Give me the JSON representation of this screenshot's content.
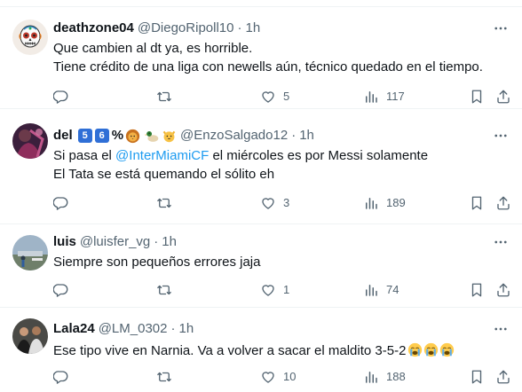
{
  "tweets": [
    {
      "display_name": "deathzone04",
      "handle": "@DiegoRipoll10",
      "time": "1h",
      "lines": [
        "Que cambien al dt ya, es horrible.",
        "Tiene crédito de una liga con newells aún, técnico quedado en el tiempo."
      ],
      "likes": "5",
      "views": "117"
    },
    {
      "display_name": "del",
      "name_badges": [
        "5",
        "6"
      ],
      "name_suffix": "%",
      "name_emojis": [
        "lion-emoji",
        "duck-emoji",
        "cat-emoji"
      ],
      "handle": "@EnzoSalgado12",
      "time": "1h",
      "line1_prefix": "Si pasa el ",
      "line1_mention": "@InterMiamiCF",
      "line1_suffix": " el miércoles es por Messi solamente",
      "line2": "El Tata se está quemando el sólito eh",
      "likes": "3",
      "views": "189"
    },
    {
      "display_name": "luis",
      "handle": "@luisfer_vg",
      "time": "1h",
      "lines": [
        "Siempre son pequeños errores jaja"
      ],
      "likes": "1",
      "views": "74"
    },
    {
      "display_name": "Lala24",
      "handle": "@LM_0302",
      "time": "1h",
      "line1": "Ese tipo vive en Narnia. Va a volver a sacar el maldito 3-5-2",
      "line1_emojis": [
        "loudly-crying-face-emoji",
        "loudly-crying-face-emoji",
        "loudly-crying-face-emoji"
      ],
      "likes": "10",
      "views": "188"
    }
  ],
  "separator": "·",
  "icons": [
    "reply-icon",
    "retweet-icon",
    "like-icon",
    "views-icon",
    "bookmark-icon",
    "share-icon",
    "more-icon"
  ],
  "colors": {
    "text": "#0f1419",
    "secondary": "#536471",
    "link": "#1d9bf0",
    "border": "#eff3f4",
    "badge": "#2f6fd6"
  }
}
